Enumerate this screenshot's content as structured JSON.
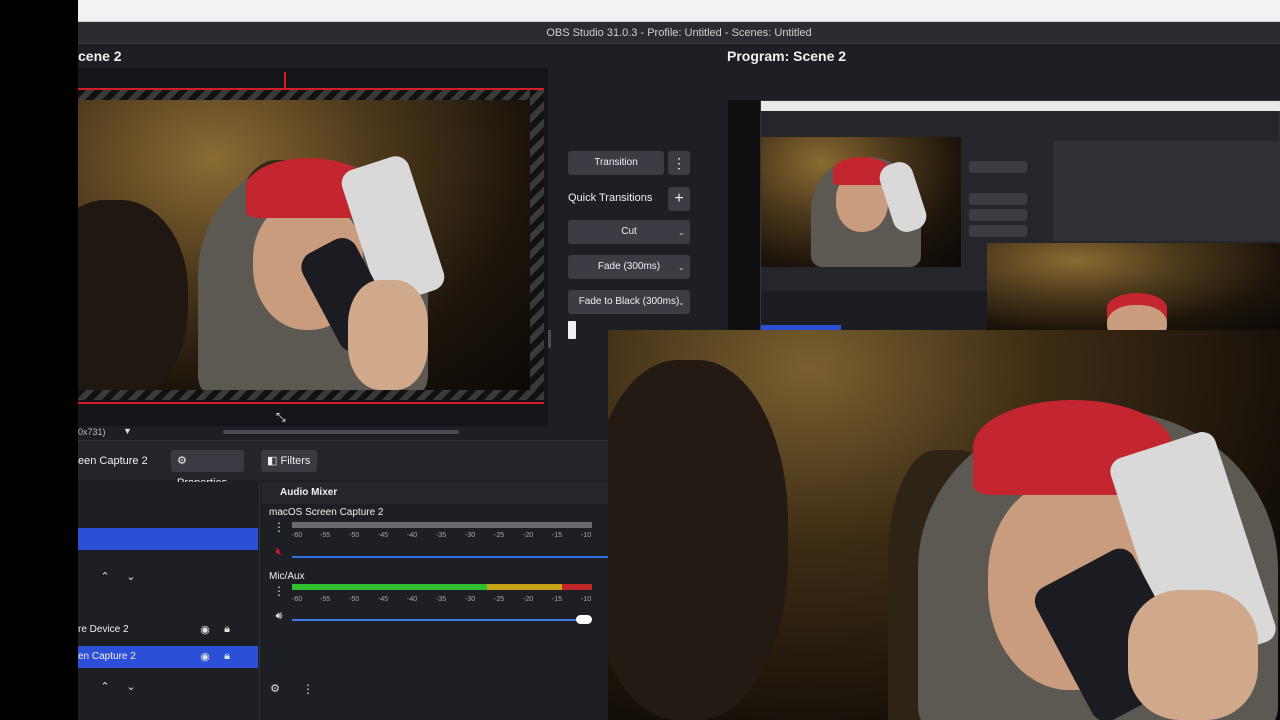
{
  "window": {
    "title": "OBS Studio 31.0.3 - Profile: Untitled - Scenes: Untitled"
  },
  "preview": {
    "label": "cene 2",
    "resolution": "0x731)"
  },
  "program": {
    "label": "Program: Scene 2"
  },
  "transitions": {
    "transition_label": "Transition",
    "quick_transitions_label": "Quick Transitions",
    "items": [
      "Cut",
      "Fade (300ms)",
      "Fade to Black (300ms)"
    ]
  },
  "source_toolbar": {
    "source_name": "een Capture 2",
    "properties_label": "Properties",
    "filters_label": "Filters"
  },
  "sources": [
    {
      "name": "re Device 2"
    },
    {
      "name": "en Capture 2"
    }
  ],
  "audio_mixer": {
    "title": "Audio Mixer",
    "channels": [
      {
        "name": "macOS Screen Capture 2"
      },
      {
        "name": "Mic/Aux"
      }
    ],
    "ticks": [
      "-60",
      "-55",
      "-50",
      "-45",
      "-40",
      "-35",
      "-30",
      "-25",
      "-20",
      "-15",
      "-10"
    ]
  },
  "colors": {
    "accent": "#2b4fd6",
    "danger": "#d61c26",
    "meter_green": "#2fc02f",
    "meter_yellow": "#c9a316"
  }
}
